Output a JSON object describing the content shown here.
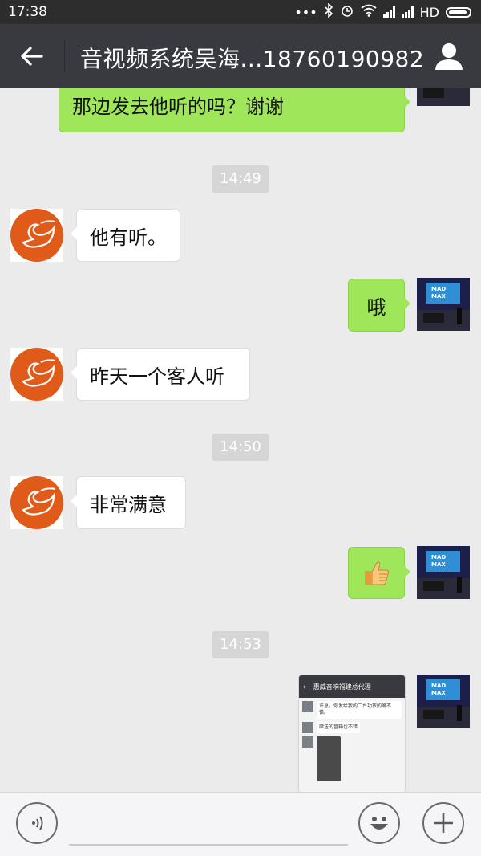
{
  "status_bar": {
    "time": "17:38",
    "network_label": "HD"
  },
  "header": {
    "title": "音视频系统吴海...18760190982",
    "back_icon": "arrow-left-icon",
    "profile_icon": "person-icon"
  },
  "messages": [
    {
      "type": "text",
      "side": "right",
      "text": "那边发去他听的吗？谢谢"
    },
    {
      "type": "time",
      "text": "14:49"
    },
    {
      "type": "text",
      "side": "left",
      "text": "他有听。"
    },
    {
      "type": "text",
      "side": "right",
      "text": "哦"
    },
    {
      "type": "text",
      "side": "left",
      "text": "昨天一个客人听"
    },
    {
      "type": "time",
      "text": "14:50"
    },
    {
      "type": "text",
      "side": "left",
      "text": "非常满意"
    },
    {
      "type": "emoji",
      "side": "right",
      "emoji": "thumbs-up-icon"
    },
    {
      "type": "time",
      "text": "14:53"
    },
    {
      "type": "image",
      "side": "right"
    }
  ],
  "screenshot_preview": {
    "title": "惠威音响福建总代理",
    "msg1": "许总，你发给我的二台功放的确不错。",
    "msg2": "赠送的音箱也不错"
  },
  "avatar_right_text": "MAD MAX",
  "input_bar": {
    "voice_icon": "voice-icon",
    "emoji_icon": "smiley-icon",
    "plus_icon": "plus-icon"
  },
  "colors": {
    "header_bg": "#393a3f",
    "statusbar_bg": "#2d2d2d",
    "chat_bg": "#ebebeb",
    "bubble_right": "#9fe65b",
    "bubble_left": "#ffffff",
    "avatar_orange": "#e05a1a"
  }
}
